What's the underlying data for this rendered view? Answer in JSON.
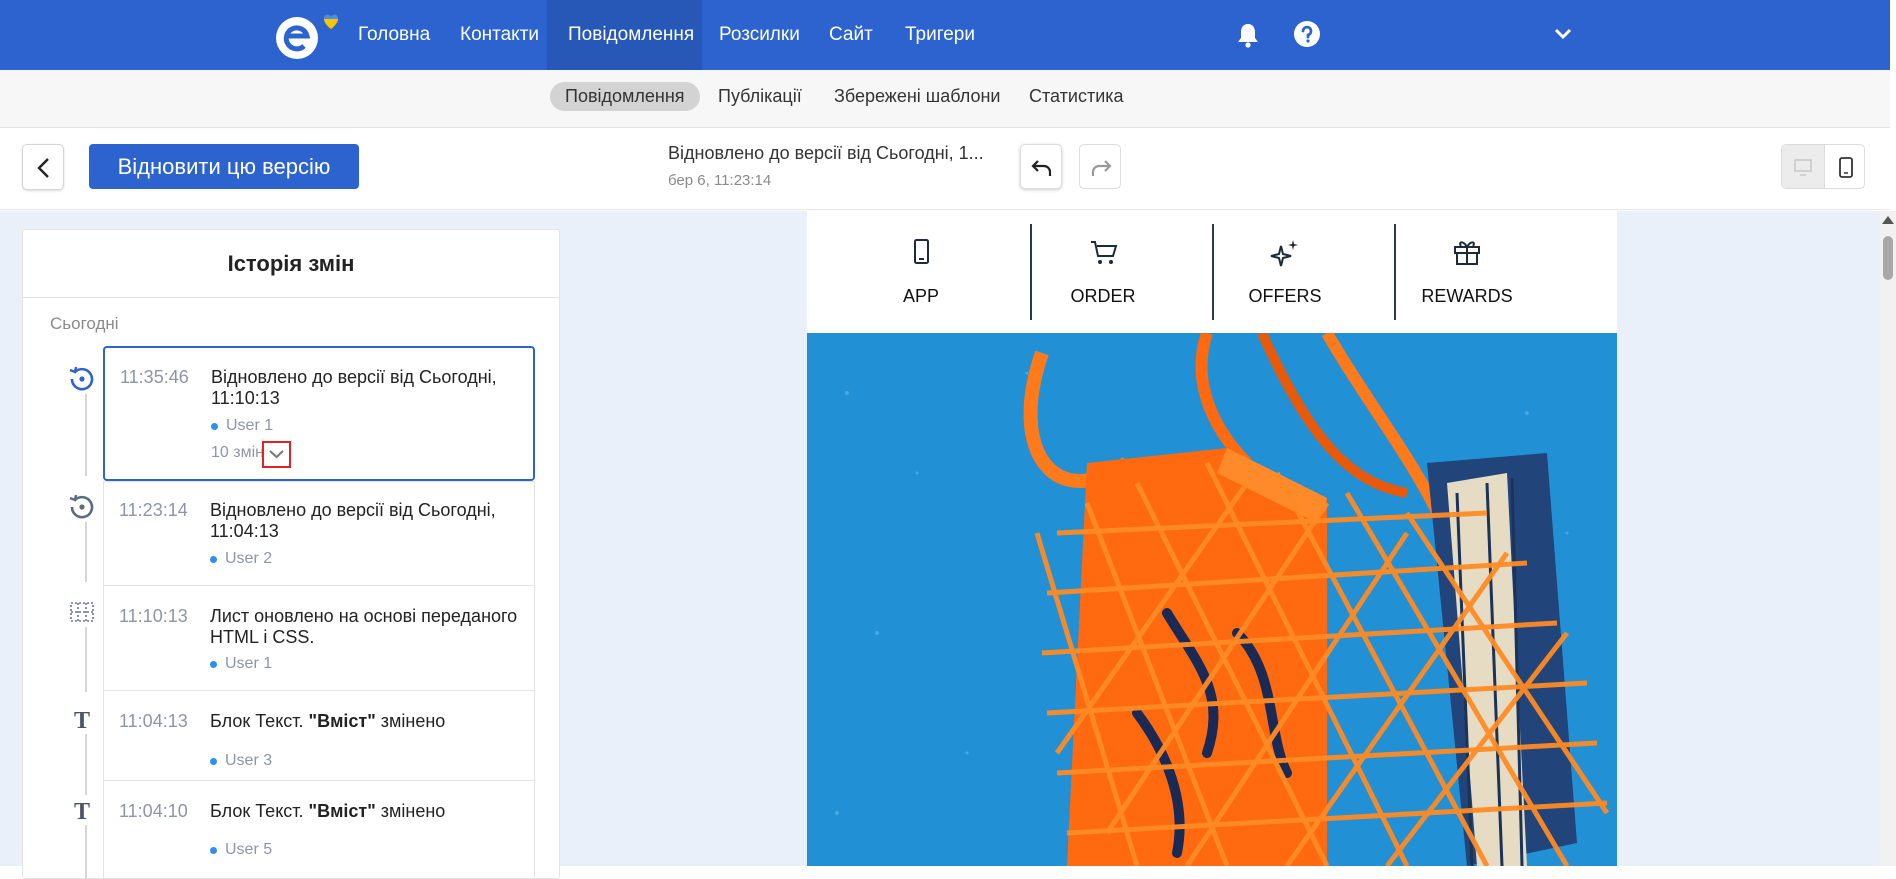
{
  "colors": {
    "brand": "#2d63cf",
    "nav_active": "#2758b8",
    "selected_border": "#2d63cf",
    "highlight_box": "#e32222",
    "user_dot": "#2d8ff0"
  },
  "nav": {
    "items": [
      {
        "label": "Головна"
      },
      {
        "label": "Контакти"
      },
      {
        "label": "Повідомлення",
        "active": true
      },
      {
        "label": "Розсилки"
      },
      {
        "label": "Сайт"
      },
      {
        "label": "Тригери"
      }
    ],
    "icons": [
      "bell-icon",
      "help-icon",
      "chevron-down-icon"
    ]
  },
  "subnav": {
    "items": [
      {
        "label": "Повідомлення",
        "active": true
      },
      {
        "label": "Публікації"
      },
      {
        "label": "Збережені шаблони"
      },
      {
        "label": "Статистика"
      }
    ]
  },
  "toolbar": {
    "restore_label": "Відновити цю версію",
    "version_title": "Відновлено до версії від Сьогодні, 1...",
    "version_date": "бер 6, 11:23:14",
    "icons": [
      "back-arrow-icon",
      "undo-icon",
      "redo-icon",
      "desktop-icon",
      "mobile-icon"
    ]
  },
  "history": {
    "title": "Історія змін",
    "group_label": "Сьогодні",
    "entries": [
      {
        "time": "11:35:46",
        "text": "Відновлено до версії від Сьогодні, 11:10:13",
        "user": "User 1",
        "changes": "10 змін",
        "icon": "restore-icon",
        "selected": true
      },
      {
        "time": "11:23:14",
        "text": "Відновлено до версії від Сьогодні, 11:04:13",
        "user": "User 2",
        "icon": "restore-icon"
      },
      {
        "time": "11:10:13",
        "text": "Лист оновлено на основі переданого HTML і CSS.",
        "user": "User 1",
        "icon": "html-grid-icon"
      },
      {
        "time": "11:04:13",
        "text_prefix": "Блок Текст. ",
        "text_bold": "\"Вміст\"",
        "text_suffix": " змінено",
        "user": "User 3",
        "icon": "text-t-icon"
      },
      {
        "time": "11:04:10",
        "text_prefix": "Блок Текст. ",
        "text_bold": "\"Вміст\"",
        "text_suffix": " змінено",
        "user": "User 5",
        "icon": "text-t-icon"
      }
    ]
  },
  "preview": {
    "menu": [
      {
        "label": "APP",
        "icon": "phone-icon"
      },
      {
        "label": "ORDER",
        "icon": "cart-icon"
      },
      {
        "label": "OFFERS",
        "icon": "sparkle-icon"
      },
      {
        "label": "REWARDS",
        "icon": "gift-icon"
      }
    ],
    "hero": "orange-mesh-bag-illustration"
  }
}
